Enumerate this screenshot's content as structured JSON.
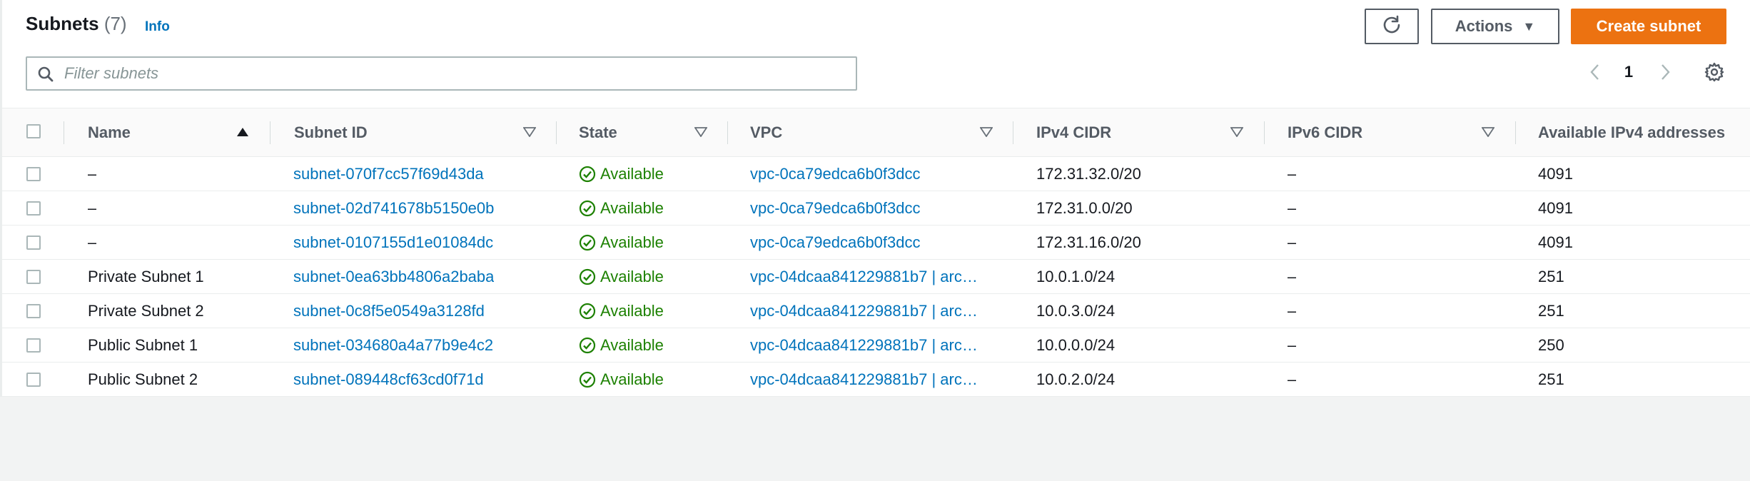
{
  "header": {
    "title": "Subnets",
    "count": "(7)",
    "info": "Info",
    "actions_label": "Actions",
    "create_label": "Create subnet"
  },
  "filter": {
    "placeholder": "Filter subnets"
  },
  "pagination": {
    "current_page": "1"
  },
  "table": {
    "columns": [
      "Name",
      "Subnet ID",
      "State",
      "VPC",
      "IPv4 CIDR",
      "IPv6 CIDR",
      "Available IPv4 addresses"
    ],
    "rows": [
      {
        "name": "–",
        "subnet_id": "subnet-070f7cc57f69d43da",
        "state": "Available",
        "vpc": "vpc-0ca79edca6b0f3dcc",
        "ipv4": "172.31.32.0/20",
        "ipv6": "–",
        "available": "4091"
      },
      {
        "name": "–",
        "subnet_id": "subnet-02d741678b5150e0b",
        "state": "Available",
        "vpc": "vpc-0ca79edca6b0f3dcc",
        "ipv4": "172.31.0.0/20",
        "ipv6": "–",
        "available": "4091"
      },
      {
        "name": "–",
        "subnet_id": "subnet-0107155d1e01084dc",
        "state": "Available",
        "vpc": "vpc-0ca79edca6b0f3dcc",
        "ipv4": "172.31.16.0/20",
        "ipv6": "–",
        "available": "4091"
      },
      {
        "name": "Private Subnet 1",
        "subnet_id": "subnet-0ea63bb4806a2baba",
        "state": "Available",
        "vpc": "vpc-04dcaa841229881b7 | arc…",
        "ipv4": "10.0.1.0/24",
        "ipv6": "–",
        "available": "251"
      },
      {
        "name": "Private Subnet 2",
        "subnet_id": "subnet-0c8f5e0549a3128fd",
        "state": "Available",
        "vpc": "vpc-04dcaa841229881b7 | arc…",
        "ipv4": "10.0.3.0/24",
        "ipv6": "–",
        "available": "251"
      },
      {
        "name": "Public Subnet 1",
        "subnet_id": "subnet-034680a4a77b9e4c2",
        "state": "Available",
        "vpc": "vpc-04dcaa841229881b7 | arc…",
        "ipv4": "10.0.0.0/24",
        "ipv6": "–",
        "available": "250"
      },
      {
        "name": "Public Subnet 2",
        "subnet_id": "subnet-089448cf63cd0f71d",
        "state": "Available",
        "vpc": "vpc-04dcaa841229881b7 | arc…",
        "ipv4": "10.0.2.0/24",
        "ipv6": "–",
        "available": "251"
      }
    ]
  },
  "colors": {
    "accent": "#ec7211",
    "link": "#0073bb",
    "success": "#1d8102"
  }
}
